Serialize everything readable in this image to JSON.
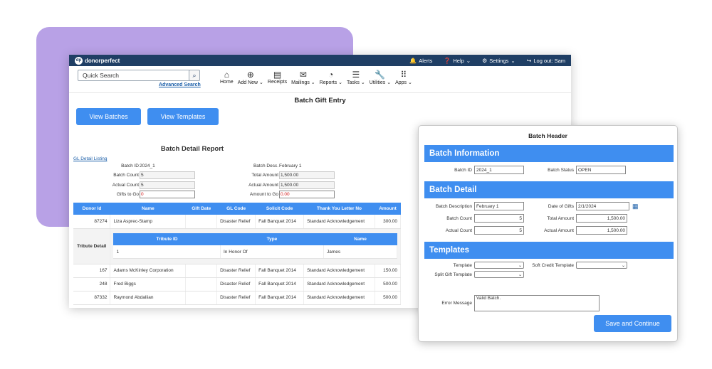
{
  "app": {
    "logo_mark": "dp",
    "name": "donorperfect"
  },
  "topbar": {
    "alerts": "Alerts",
    "help": "Help",
    "settings": "Settings",
    "logout": "Log out: Sam"
  },
  "search": {
    "placeholder": "Quick Search",
    "advanced": "Advanced Search"
  },
  "menus": [
    {
      "icon": "home-icon",
      "label": "Home"
    },
    {
      "icon": "add-icon",
      "label": "Add New"
    },
    {
      "icon": "receipt-icon",
      "label": "Receipts"
    },
    {
      "icon": "mail-icon",
      "label": "Mailings"
    },
    {
      "icon": "pie-chart-icon",
      "label": "Reports"
    },
    {
      "icon": "tasks-icon",
      "label": "Tasks"
    },
    {
      "icon": "wrench-icon",
      "label": "Utilities"
    },
    {
      "icon": "apps-grid-icon",
      "label": "Apps"
    }
  ],
  "page": {
    "title": "Batch Gift Entry",
    "view_batches": "View Batches",
    "view_templates": "View Templates",
    "report_title": "Batch Detail Report",
    "gl_link": "GL Detail Listing"
  },
  "report_fields": {
    "batch_id_label": "Batch ID",
    "batch_id": "2024_1",
    "batch_desc_label": "Batch Desc.",
    "batch_desc": "February 1",
    "batch_count_label": "Batch Count",
    "batch_count": "5",
    "total_amount_label": "Total Amount",
    "total_amount": "1,500.00",
    "actual_count_label": "Actual Count",
    "actual_count": "5",
    "actual_amount_label": "Actual Amount",
    "actual_amount": "1,500.00",
    "gifts_to_go_label": "Gifts to Go",
    "gifts_to_go": "0",
    "amount_to_go_label": "Amount to Go",
    "amount_to_go": "0.00"
  },
  "table": {
    "headers": [
      "Donor Id",
      "Name",
      "Gift Date",
      "GL Code",
      "Solicit Code",
      "Thank You Letter No",
      "Amount"
    ],
    "rows": [
      [
        "87274",
        "Liza Asprec-Stamp",
        "",
        "Disaster Relief",
        "Fall Banquet 2014",
        "Standard Acknowledgement",
        "300.00"
      ],
      [
        "167",
        "Adams McKinley Corporation",
        "",
        "Disaster Relief",
        "Fall Banquet 2014",
        "Standard Acknowledgement",
        "150.00"
      ],
      [
        "248",
        "Fred Biggs",
        "",
        "Disaster Relief",
        "Fall Banquet 2014",
        "Standard Acknowledgement",
        "500.00"
      ],
      [
        "87332",
        "Raymond Abdaliian",
        "",
        "Disaster Relief",
        "Fall Banquet 2014",
        "Standard Acknowledgement",
        "500.00"
      ]
    ],
    "tribute": {
      "label": "Tribute Detail",
      "headers": [
        "Tribute ID",
        "Type",
        "Name"
      ],
      "row": [
        "1",
        "In Honor Of",
        "James"
      ]
    }
  },
  "dialog": {
    "title": "Batch Header",
    "sec_info": "Batch Information",
    "batch_id_label": "Batch ID",
    "batch_id": "2024_1",
    "batch_status_label": "Batch Status",
    "batch_status": "OPEN",
    "sec_detail": "Batch Detail",
    "batch_desc_label": "Batch Description",
    "batch_desc": "February 1",
    "date_of_gifts_label": "Date of Gifts",
    "date_of_gifts": "2/1/2024",
    "batch_count_label": "Batch Count",
    "batch_count": "5",
    "total_amount_label": "Total Amount",
    "total_amount": "1,500.00",
    "actual_count_label": "Actual Count",
    "actual_count": "5",
    "actual_amount_label": "Actual Amount",
    "actual_amount": "1,500.00",
    "sec_templates": "Templates",
    "template_label": "Template",
    "soft_credit_label": "Soft Credit Template",
    "split_gift_label": "Split Gift Template",
    "error_label": "Error Message",
    "error_msg": "Valid Batch.",
    "save": "Save and Continue"
  },
  "colors": {
    "accent": "#3f8ef0",
    "topbar": "#1f3e64",
    "backdrop": "#b8a1e6",
    "alert": "#d31b1b"
  }
}
